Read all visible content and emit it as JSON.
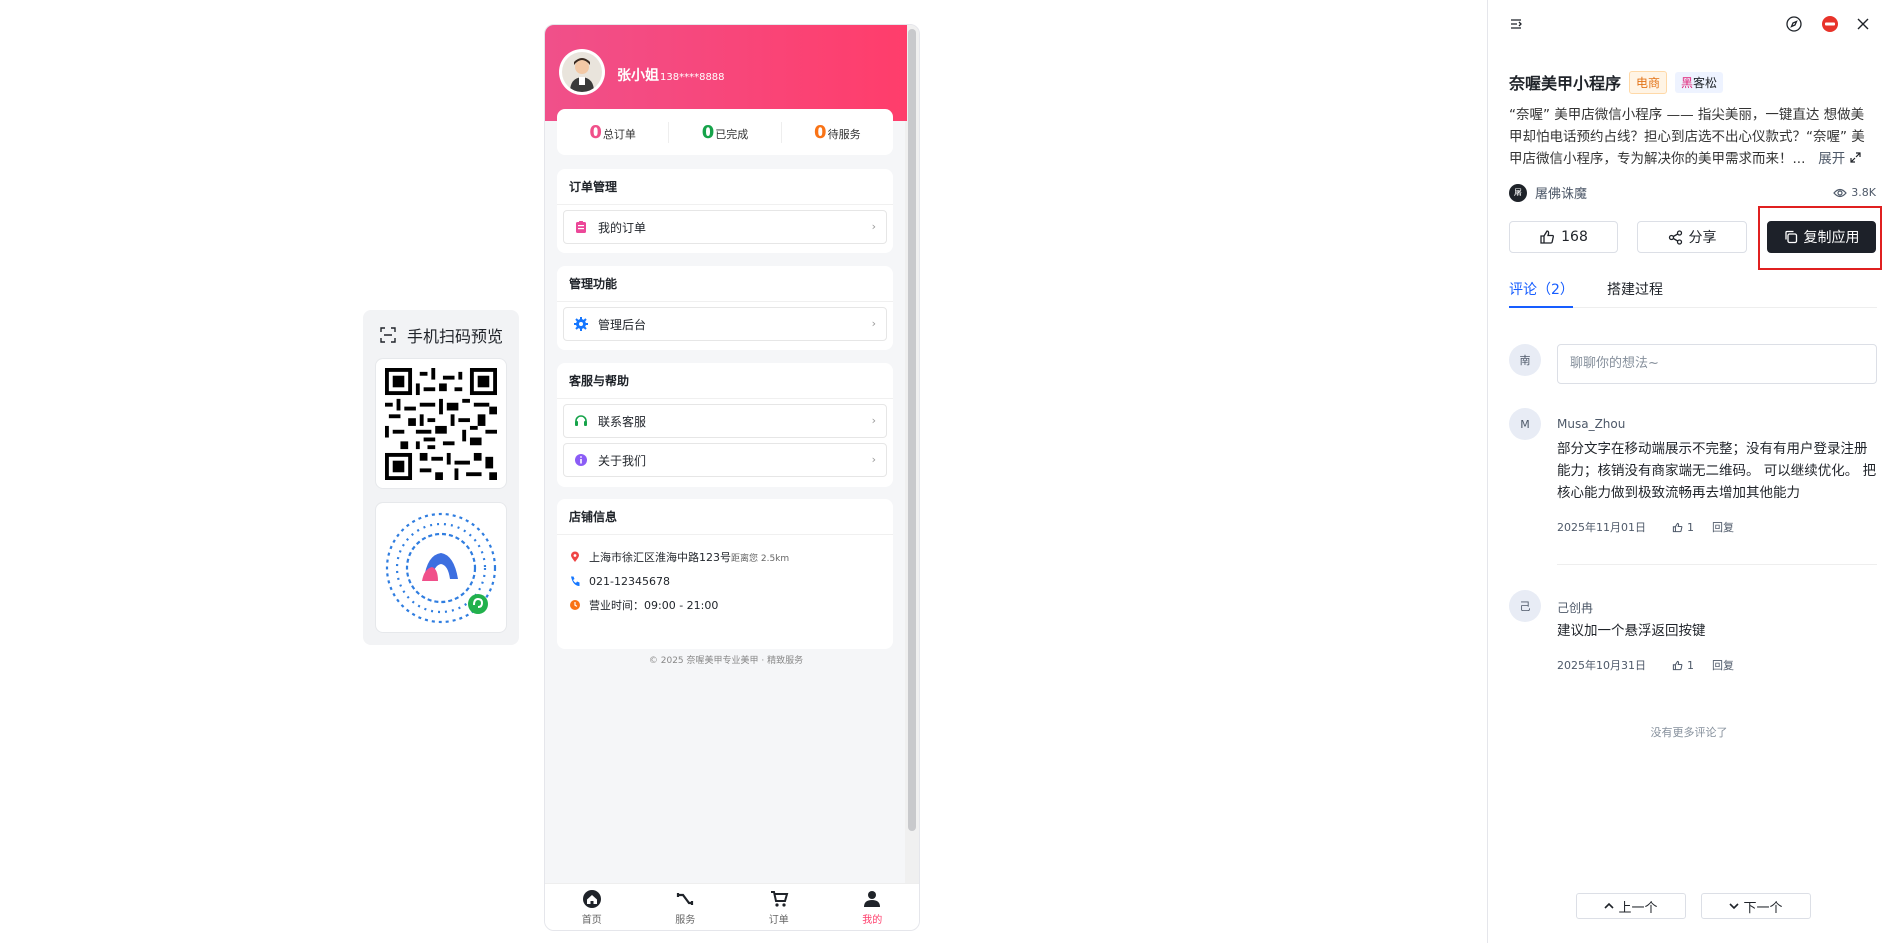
{
  "qr_panel": {
    "title": "手机扫码预览"
  },
  "phone": {
    "user": {
      "name": "张小姐",
      "phone": "138****8888"
    },
    "stats": [
      {
        "value": "0",
        "label": "总订单",
        "color": "#f0508a"
      },
      {
        "value": "0",
        "label": "已完成",
        "color": "#16a34a"
      },
      {
        "value": "0",
        "label": "待服务",
        "color": "#f97316"
      }
    ],
    "sections": {
      "orders": {
        "title": "订单管理",
        "items": [
          "我的订单"
        ]
      },
      "admin": {
        "title": "管理功能",
        "items": [
          "管理后台"
        ]
      },
      "help": {
        "title": "客服与帮助",
        "items": [
          "联系客服",
          "关于我们"
        ]
      },
      "store": {
        "title": "店铺信息",
        "address": "上海市徐汇区淮海中路123号",
        "distance": "距离您 2.5km",
        "tel": "021-12345678",
        "hours": "营业时间：09:00 - 21:00"
      }
    },
    "copyright": "© 2025 奈喔美甲专业美甲 · 精致服务",
    "tabs": [
      "首页",
      "服务",
      "订单",
      "我的"
    ],
    "accent": "#ff3d6b"
  },
  "detail": {
    "title": "奈喔美甲小程序",
    "tag1": "电商",
    "tag2_mark": "黑",
    "tag2_rest": "客松",
    "description": "“奈喔” 美甲店微信小程序 —— 指尖美丽，一键直达 想做美甲却怕电话预约占线？担心到店选不出心仪款式？“奈喔” 美甲店微信小程序，专为解决你的美甲需求而来！...",
    "expand": "展开",
    "author": "屠佛诛魔",
    "author_initial": "屠",
    "views": "3.8K",
    "like_count": "168",
    "share_label": "分享",
    "copy_label": "复制应用",
    "tab_comments": "评论（2）",
    "tab_process": "搭建过程",
    "input_avatar": "南",
    "input_placeholder": "聊聊你的想法~",
    "comments": [
      {
        "avatar": "M",
        "user": "Musa_Zhou",
        "text": "部分文字在移动端展示不完整；没有有用户登录注册能力；核销没有商家端无二维码。 可以继续优化。 把核心能力做到极致流畅再去增加其他能力",
        "date": "2025年11月01日",
        "likes": "1",
        "reply": "回复"
      },
      {
        "avatar": "己",
        "user": "己创冉",
        "text": "建议加一个悬浮返回按键",
        "date": "2025年10月31日",
        "likes": "1",
        "reply": "回复"
      }
    ],
    "no_more": "没有更多评论了",
    "prev": "上一个",
    "next": "下一个"
  }
}
